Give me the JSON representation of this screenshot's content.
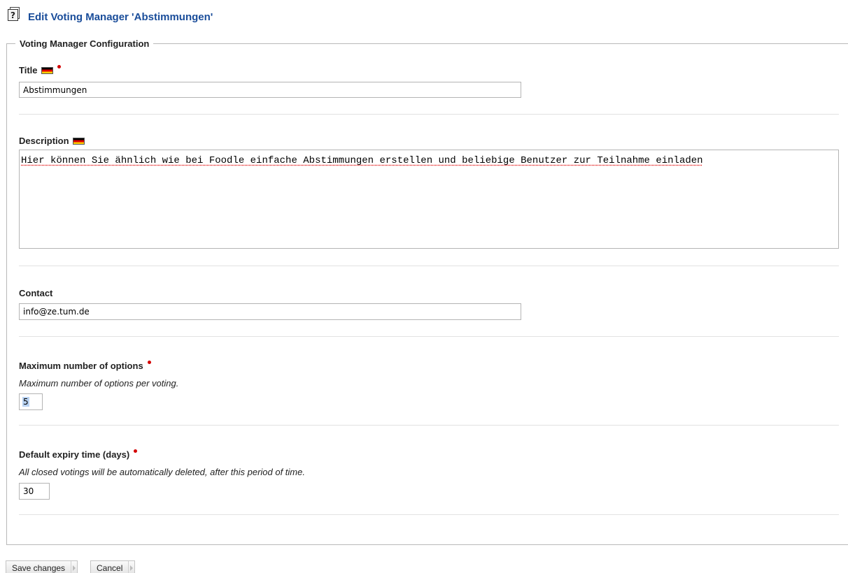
{
  "header": {
    "icon": "help-document-icon",
    "icon_glyph": "?",
    "title": "Edit Voting Manager 'Abstimmungen'"
  },
  "form": {
    "legend": "Voting Manager Configuration",
    "title_field": {
      "label": "Title",
      "value": "Abstimmungen"
    },
    "description_field": {
      "label": "Description",
      "value": "Hier können Sie ähnlich wie bei Foodle einfache Abstimmungen erstellen und beliebige Benutzer zur Teilnahme einladen"
    },
    "contact_field": {
      "label": "Contact",
      "value": "info@ze.tum.de"
    },
    "max_options_field": {
      "label": "Maximum number of options",
      "hint": "Maximum number of options per voting.",
      "value": "5"
    },
    "expiry_field": {
      "label": "Default expiry time (days)",
      "hint": "All closed votings will be automatically deleted, after this period of time.",
      "value": "30"
    }
  },
  "actions": {
    "save_label": "Save changes",
    "cancel_label": "Cancel"
  },
  "colors": {
    "title": "#1a4d9a",
    "required": "#d40000",
    "flag": [
      "#000000",
      "#dd0000",
      "#ffce00"
    ]
  }
}
